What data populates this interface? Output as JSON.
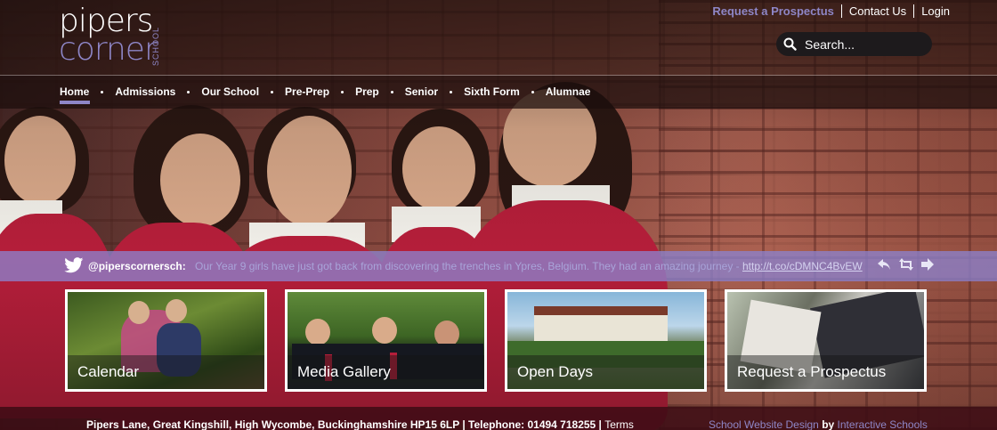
{
  "brand": {
    "logo_line1": "pipers",
    "logo_line2": "corner",
    "logo_vertical": "SCHOOL",
    "accent_color": "#8e86c7"
  },
  "top_links": [
    {
      "label": "Request a Prospectus"
    },
    {
      "label": "Contact Us"
    },
    {
      "label": "Login"
    }
  ],
  "search": {
    "placeholder": "Search...",
    "icon": "search-icon"
  },
  "nav": {
    "items": [
      {
        "label": "Home",
        "active": true
      },
      {
        "label": "Admissions"
      },
      {
        "label": "Our School"
      },
      {
        "label": "Pre-Prep"
      },
      {
        "label": "Prep"
      },
      {
        "label": "Senior"
      },
      {
        "label": "Sixth Form"
      },
      {
        "label": "Alumnae"
      }
    ]
  },
  "twitter": {
    "icon": "twitter-bird-icon",
    "handle": "@piperscornersch:",
    "message": "Our Year 9 girls have just got back from discovering the trenches in Ypres, Belgium. They had an amazing journey - ",
    "link": "http://t.co/cDMNC4BvEW",
    "action_icons": [
      "reply-icon",
      "retweet-icon",
      "forward-icon"
    ]
  },
  "tiles": [
    {
      "label": "Calendar"
    },
    {
      "label": "Media Gallery"
    },
    {
      "label": "Open Days"
    },
    {
      "label": "Request a Prospectus"
    }
  ],
  "footer": {
    "address": "Pipers Lane, Great Kingshill, High Wycombe, Buckinghamshire HP15 6LP | Telephone: 01494 718255 | ",
    "terms": "Terms",
    "credit_prefix": "School Website Design",
    "credit_by": "by",
    "credit_company": "Interactive Schools"
  }
}
